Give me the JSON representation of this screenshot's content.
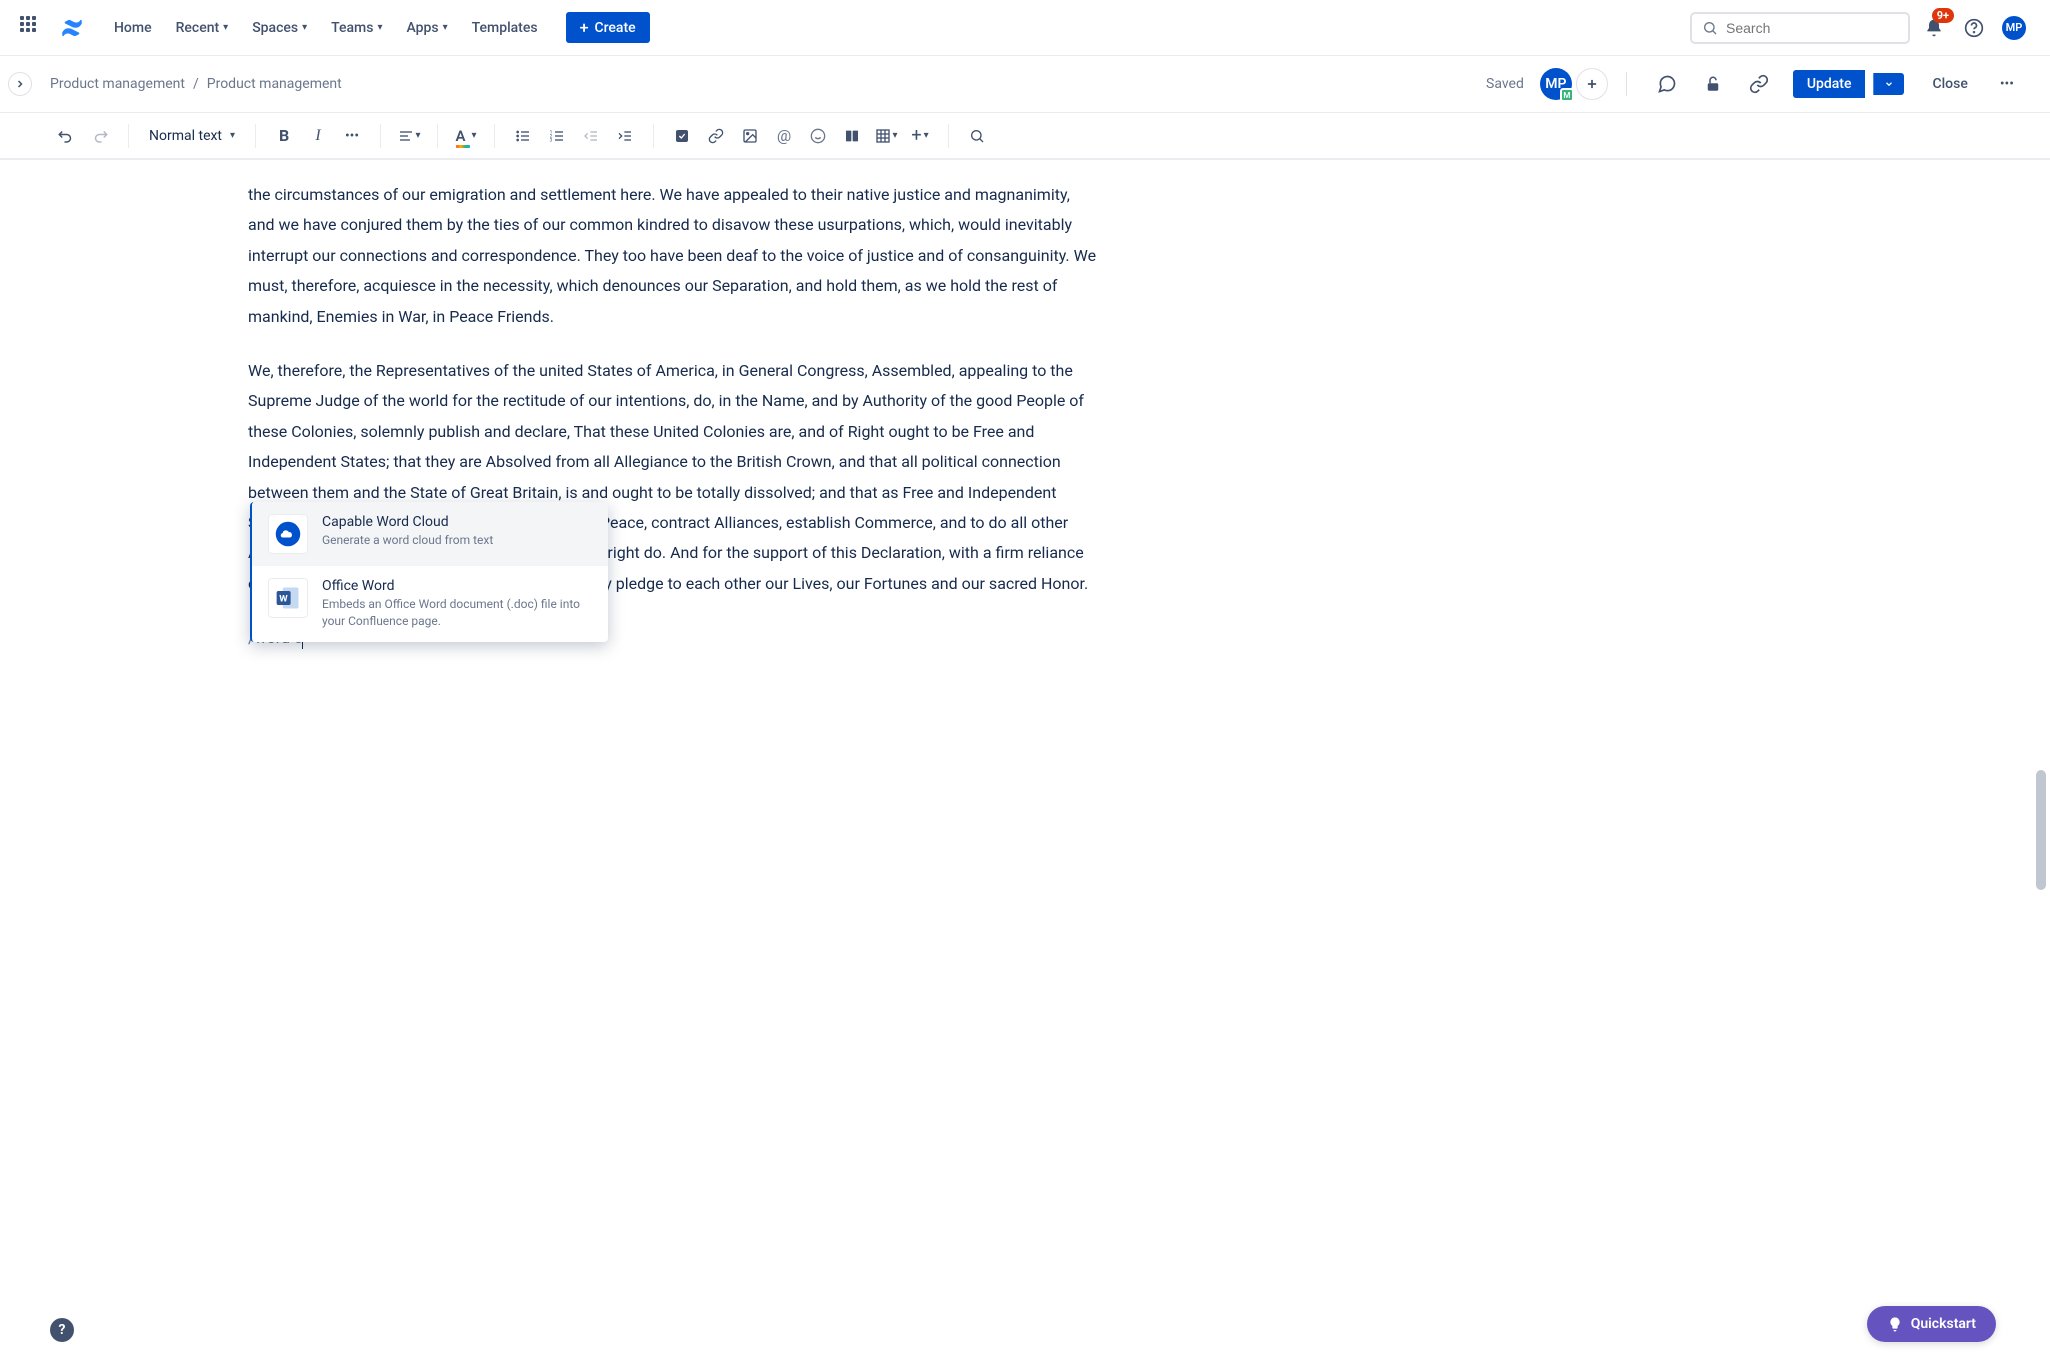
{
  "nav": {
    "home": "Home",
    "recent": "Recent",
    "spaces": "Spaces",
    "teams": "Teams",
    "apps": "Apps",
    "templates": "Templates",
    "create": "Create",
    "search_placeholder": "Search",
    "notif_badge": "9+",
    "avatar_initials": "MP"
  },
  "header": {
    "breadcrumb_space": "Product management",
    "breadcrumb_page": "Product management",
    "saved": "Saved",
    "editor_initials": "MP",
    "update": "Update",
    "close": "Close"
  },
  "toolbar": {
    "text_style": "Normal text"
  },
  "content": {
    "para1": "the circumstances of our emigration and settlement here. We have appealed to their native justice and magnanimity, and we have conjured them by the ties of our common kindred to disavow these usurpations, which, would inevitably interrupt our connections and correspondence. They too have been deaf to the voice of justice and of consanguinity. We must, therefore, acquiesce in the necessity, which denounces our Separation, and hold them, as we hold the rest of mankind, Enemies in War, in Peace Friends.",
    "para2": "We, therefore, the Representatives of the united States of America, in General Congress, Assembled, appealing to the Supreme Judge of the world for the rectitude of our intentions, do, in the Name, and by Authority of the good People of these Colonies, solemnly publish and declare, That these United Colonies are, and of Right ought to be Free and Independent States; that they are Absolved from all Allegiance to the British Crown, and that all political connection between them and the State of Great Britain, is and ought to be totally dissolved; and that as Free and Independent States, they have full Power to levy War, conclude Peace, contract Alliances, establish Commerce, and to do all other Acts and Things which Independent States may of right do. And for the support of this Declaration, with a firm reliance on the Protection of Divine Providence, we mutually pledge to each other our Lives, our Fortunes and our sacred Honor.",
    "slash_input": "/word c"
  },
  "slash_menu": {
    "items": [
      {
        "title": "Capable Word Cloud",
        "desc": "Generate a word cloud from text"
      },
      {
        "title": "Office Word",
        "desc": "Embeds an Office Word document (.doc) file into your Confluence page."
      }
    ]
  },
  "footer": {
    "quickstart": "Quickstart"
  }
}
